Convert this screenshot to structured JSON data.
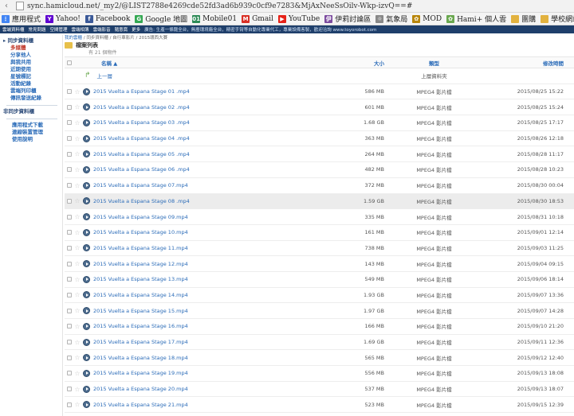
{
  "address_bar": {
    "url": "sync.hamicloud.net/_my2/@LIST2788e4269cde52fd3ad6b939c0cf9e7283&MjAxNeeSsOilv-Wkp-izvQ==#"
  },
  "bookmarks": [
    {
      "label": "應用程式",
      "icon": "apps-grid-icon",
      "color": "#4285f4",
      "glyph": "⋮"
    },
    {
      "label": "Yahoo!",
      "icon": "yahoo-icon",
      "color": "#5f01d1",
      "glyph": "Y"
    },
    {
      "label": "Facebook",
      "icon": "facebook-icon",
      "color": "#3b5998",
      "glyph": "f"
    },
    {
      "label": "Google 地圖",
      "icon": "google-maps-icon",
      "color": "#34a853",
      "glyph": "G"
    },
    {
      "label": "Mobile01",
      "icon": "mobile01-icon",
      "color": "#2e8b57",
      "glyph": "01"
    },
    {
      "label": "Gmail",
      "icon": "gmail-icon",
      "color": "#d93025",
      "glyph": "M"
    },
    {
      "label": "YouTube",
      "icon": "youtube-icon",
      "color": "#e62117",
      "glyph": "▶"
    },
    {
      "label": "伊莉討論區",
      "icon": "eyny-icon",
      "color": "#7b4a9e",
      "glyph": "伊"
    },
    {
      "label": "氣象局",
      "icon": "weather-icon",
      "color": "#888888",
      "glyph": "☼"
    },
    {
      "label": "MOD",
      "icon": "mod-icon",
      "color": "#b8860b",
      "glyph": "✿"
    },
    {
      "label": "Hami+ 個人雲",
      "icon": "hami-icon",
      "color": "#6aa84f",
      "glyph": "✿"
    },
    {
      "label": "團購",
      "icon": "folder-icon",
      "color": "#e2b23f",
      "glyph": ""
    },
    {
      "label": "學校網站",
      "icon": "folder-icon",
      "color": "#e2b23f",
      "glyph": ""
    },
    {
      "label": "單車",
      "icon": "folder-icon",
      "color": "#e2b23f",
      "glyph": ""
    }
  ],
  "topbar": {
    "items": [
      "雲端資料櫃",
      "常見問題",
      "空間管理",
      "雲端相簿",
      "雲端影音",
      "隨意窩",
      "更多"
    ],
    "ad": "廣告: 生產一條龍全台，無塵環境廠全台，精密手臂等自動化專業代工，專業設備客製，歡迎洽詢 www.toyorobot.com"
  },
  "sidebar": {
    "group_sync": "同步資料櫃",
    "items": [
      {
        "label": "多媒體",
        "selected": true
      },
      {
        "label": "分享他人",
        "selected": false
      },
      {
        "label": "與我共用",
        "selected": false
      },
      {
        "label": "近期使用",
        "selected": false
      },
      {
        "label": "星號標記",
        "selected": false
      },
      {
        "label": "活動紀錄",
        "selected": false
      },
      {
        "label": "雲端列印櫃",
        "selected": false
      },
      {
        "label": "傳訊發送紀錄",
        "selected": false
      }
    ],
    "group_nonsync": "非同步資料櫃",
    "links": [
      "應用程式下載",
      "連線裝置管理",
      "使用說明"
    ]
  },
  "breadcrumb": {
    "root": "我的雲櫃",
    "path": " / 同步資料櫃 / 自行車影片 / 2015環西大賽"
  },
  "list": {
    "title": "檔案列表",
    "count": "有 21 個物件",
    "headers": {
      "name": "名稱 ▲",
      "size": "大小",
      "type": "類型",
      "date": "修改時間"
    },
    "parent": {
      "label": "上一層",
      "type": "上層資料夾"
    },
    "files": [
      {
        "name": "2015 Vuelta a Espana Stage 01 .mp4",
        "size": "586 MB",
        "type": "MPEG4 影片檔",
        "date": "2015/08/25 15:22"
      },
      {
        "name": "2015 Vuelta a Espana Stage 02 .mp4",
        "size": "601 MB",
        "type": "MPEG4 影片檔",
        "date": "2015/08/25 15:24"
      },
      {
        "name": "2015 Vuelta a Espana Stage 03 .mp4",
        "size": "1.68 GB",
        "type": "MPEG4 影片檔",
        "date": "2015/08/25 17:17"
      },
      {
        "name": "2015 Vuelta a Espana Stage 04 .mp4",
        "size": "363 MB",
        "type": "MPEG4 影片檔",
        "date": "2015/08/26 12:18"
      },
      {
        "name": "2015 Vuelta a Espana Stage 05 .mp4",
        "size": "264 MB",
        "type": "MPEG4 影片檔",
        "date": "2015/08/28 11:17"
      },
      {
        "name": "2015 Vuelta a Espana Stage 06 .mp4",
        "size": "482 MB",
        "type": "MPEG4 影片檔",
        "date": "2015/08/28 10:23"
      },
      {
        "name": "2015 Vuelta a Espana Stage 07.mp4",
        "size": "372 MB",
        "type": "MPEG4 影片檔",
        "date": "2015/08/30 00:04"
      },
      {
        "name": "2015 Vuelta a Espana Stage 08 .mp4",
        "size": "1.59 GB",
        "type": "MPEG4 影片檔",
        "date": "2015/08/30 18:53",
        "highlight": true
      },
      {
        "name": "2015 Vuelta a Espana Stage 09.mp4",
        "size": "335 MB",
        "type": "MPEG4 影片檔",
        "date": "2015/08/31 10:18"
      },
      {
        "name": "2015 Vuelta a Espana Stage 10.mp4",
        "size": "161 MB",
        "type": "MPEG4 影片檔",
        "date": "2015/09/01 12:14"
      },
      {
        "name": "2015 Vuelta a Espana Stage 11.mp4",
        "size": "738 MB",
        "type": "MPEG4 影片檔",
        "date": "2015/09/03 11:25"
      },
      {
        "name": "2015 Vuelta a Espana Stage 12.mp4",
        "size": "143 MB",
        "type": "MPEG4 影片檔",
        "date": "2015/09/04 09:15"
      },
      {
        "name": "2015 Vuelta a Espana Stage 13.mp4",
        "size": "549 MB",
        "type": "MPEG4 影片檔",
        "date": "2015/09/06 18:14"
      },
      {
        "name": "2015 Vuelta a Espana Stage 14.mp4",
        "size": "1.93 GB",
        "type": "MPEG4 影片檔",
        "date": "2015/09/07 13:36"
      },
      {
        "name": "2015 Vuelta a Espana Stage 15.mp4",
        "size": "1.97 GB",
        "type": "MPEG4 影片檔",
        "date": "2015/09/07 14:28"
      },
      {
        "name": "2015 Vuelta a Espana Stage 16.mp4",
        "size": "166 MB",
        "type": "MPEG4 影片檔",
        "date": "2015/09/10 21:20"
      },
      {
        "name": "2015 Vuelta a Espana Stage 17.mp4",
        "size": "1.69 GB",
        "type": "MPEG4 影片檔",
        "date": "2015/09/11 12:36"
      },
      {
        "name": "2015 Vuelta a Espana Stage 18.mp4",
        "size": "565 MB",
        "type": "MPEG4 影片檔",
        "date": "2015/09/12 12:40"
      },
      {
        "name": "2015 Vuelta a Espana Stage 19.mp4",
        "size": "556 MB",
        "type": "MPEG4 影片檔",
        "date": "2015/09/13 18:08"
      },
      {
        "name": "2015 Vuelta a Espana Stage 20.mp4",
        "size": "537 MB",
        "type": "MPEG4 影片檔",
        "date": "2015/09/13 18:07"
      },
      {
        "name": "2015 Vuelta a Espana Stage 21.mp4",
        "size": "523 MB",
        "type": "MPEG4 影片檔",
        "date": "2015/09/15 12:39"
      }
    ]
  }
}
